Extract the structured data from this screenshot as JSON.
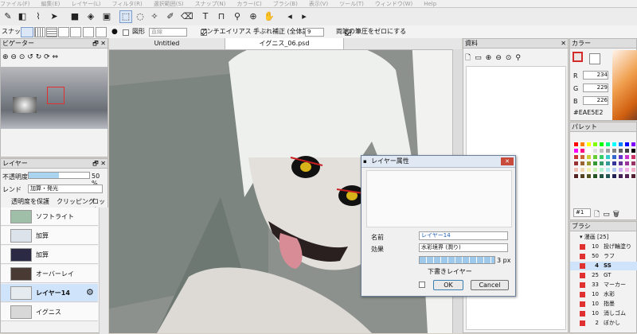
{
  "menubar": {
    "items": [
      "ファイル(F)",
      "編集(E)",
      "レイヤー(L)",
      "フィルタ(R)",
      "選択範囲(S)",
      "スナップ(N)",
      "カラー(C)",
      "ブラシ(B)",
      "表示(V)",
      "ツール(T)",
      "ウィンドウ(W)",
      "Help"
    ]
  },
  "toolbar2": {
    "snap_label": "スナップ",
    "shape_label": "図形",
    "shape_value": "直線",
    "antialias_label": "アンチエイリアス",
    "stabilizer_label": "手ぶれ補正 (全体設定)",
    "stabilizer_value": "9",
    "pressure_label": "両端の筆圧をゼロにする"
  },
  "navigator": {
    "title": "ビゲーター"
  },
  "layer_panel": {
    "title": "レイヤー",
    "opacity_label": "不透明度",
    "opacity_value": "50 %",
    "opacity_fraction": 0.5,
    "blend_label": "レンド",
    "blend_value": "加算・発光",
    "protect_label": "透明度を保護",
    "clipping_label": "クリッピング",
    "lock_label": "ロック",
    "layers": [
      {
        "name": "ソフトライト",
        "thumb": "#9fbfa8"
      },
      {
        "name": "加算",
        "thumb": "#dde3ea"
      },
      {
        "name": "加算",
        "thumb": "#2a2a44"
      },
      {
        "name": "オーバーレイ",
        "thumb": "#4a3a34"
      },
      {
        "name": "レイヤー14",
        "thumb": "#e6ebf0"
      },
      {
        "name": "イグニス",
        "thumb": "#d8d8d8"
      }
    ]
  },
  "tabs": [
    "Untitled",
    "イグニス_06.psd"
  ],
  "material_panel": {
    "title": "資料"
  },
  "color_panel": {
    "title": "カラー",
    "r_label": "R",
    "r_value": "234",
    "g_label": "G",
    "g_value": "229",
    "b_label": "B",
    "b_value": "226",
    "hex": "#EAE5E2"
  },
  "palette_panel": {
    "title": "パレット",
    "page": "#1"
  },
  "brush_panel": {
    "title": "ブラシ",
    "group": "漫画 [25]",
    "brushes": [
      {
        "size": "10",
        "name": "投げ輪塗り"
      },
      {
        "size": "50",
        "name": "ラフ"
      },
      {
        "size": "4",
        "name": "SS"
      },
      {
        "size": "25",
        "name": "GT"
      },
      {
        "size": "33",
        "name": "マーカー"
      },
      {
        "size": "10",
        "name": "水彩"
      },
      {
        "size": "10",
        "name": "指墨"
      },
      {
        "size": "10",
        "name": "消しゴム"
      },
      {
        "size": "2",
        "name": "ぼかし"
      }
    ]
  },
  "dialog": {
    "title": "レイヤー属性",
    "name_label": "名前",
    "name_value": "レイヤー14",
    "effect_label": "効果",
    "effect_value": "水彩境界 (潤り)",
    "width_value": "3 px",
    "width_fraction": 0.25,
    "under_label": "下書きレイヤー",
    "ok_label": "OK",
    "cancel_label": "Cancel"
  }
}
